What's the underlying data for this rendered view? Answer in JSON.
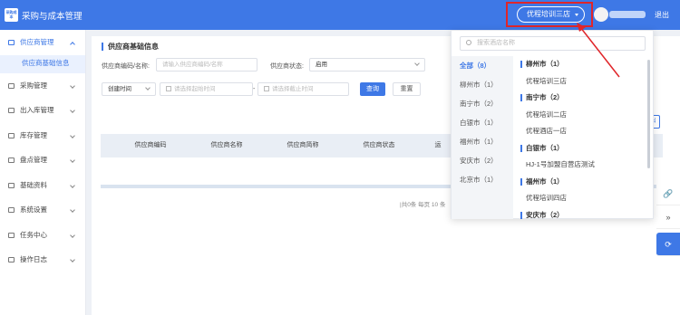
{
  "header": {
    "logo_text": "采购成本",
    "app_title": "采购与成本管理",
    "store_selector": "优程培训三店",
    "logout": "退出",
    "accent_color": "#3e78e6",
    "highlight_color": "#e0262a"
  },
  "sidebar": {
    "items": [
      {
        "label": "供应商管理",
        "icon": "supplier-icon"
      },
      {
        "label": "采购管理",
        "icon": "cart-icon"
      },
      {
        "label": "出入库管理",
        "icon": "inout-icon"
      },
      {
        "label": "库存管理",
        "icon": "stock-icon"
      },
      {
        "label": "盘点管理",
        "icon": "count-icon"
      },
      {
        "label": "基础资料",
        "icon": "data-icon"
      },
      {
        "label": "系统设置",
        "icon": "settings-icon"
      },
      {
        "label": "任务中心",
        "icon": "task-icon"
      },
      {
        "label": "操作日志",
        "icon": "log-icon"
      }
    ],
    "submenu": "供应商基础信息"
  },
  "main": {
    "title": "供应商基础信息",
    "filters": {
      "code_label": "供应商编码/名称:",
      "code_placeholder": "请输入供应商编码/名称",
      "status_label": "供应商状态:",
      "status_value": "启用",
      "time_type": "创建时间",
      "start_placeholder": "请选择起始时间",
      "separator": "-",
      "end_placeholder": "请选择截止时间",
      "query": "查询",
      "reset": "重置"
    },
    "side_button": "出",
    "table_headers": [
      "供应商编码",
      "供应商名称",
      "供应商简称",
      "供应商状态",
      "运"
    ],
    "pager": "|共0条 每页 10 条"
  },
  "dropdown": {
    "search_placeholder": "搜索酒店名称",
    "cities": [
      "全部（8）",
      "柳州市（1）",
      "南宁市（2）",
      "白银市（1）",
      "福州市（1）",
      "安庆市（2）",
      "北京市（1）"
    ],
    "groups": [
      {
        "city": "柳州市（1）",
        "stores": [
          "优程培训三店"
        ]
      },
      {
        "city": "南宁市（2）",
        "stores": [
          "优程培训二店",
          "优程酒店一店"
        ]
      },
      {
        "city": "白银市（1）",
        "stores": [
          "HJ-1号加盟自营店测试"
        ]
      },
      {
        "city": "福州市（1）",
        "stores": [
          "优程培训四店"
        ]
      },
      {
        "city": "安庆市（2）",
        "stores": []
      }
    ]
  },
  "right_tools": [
    "link-icon",
    "double-chevron-icon",
    "support-icon"
  ]
}
